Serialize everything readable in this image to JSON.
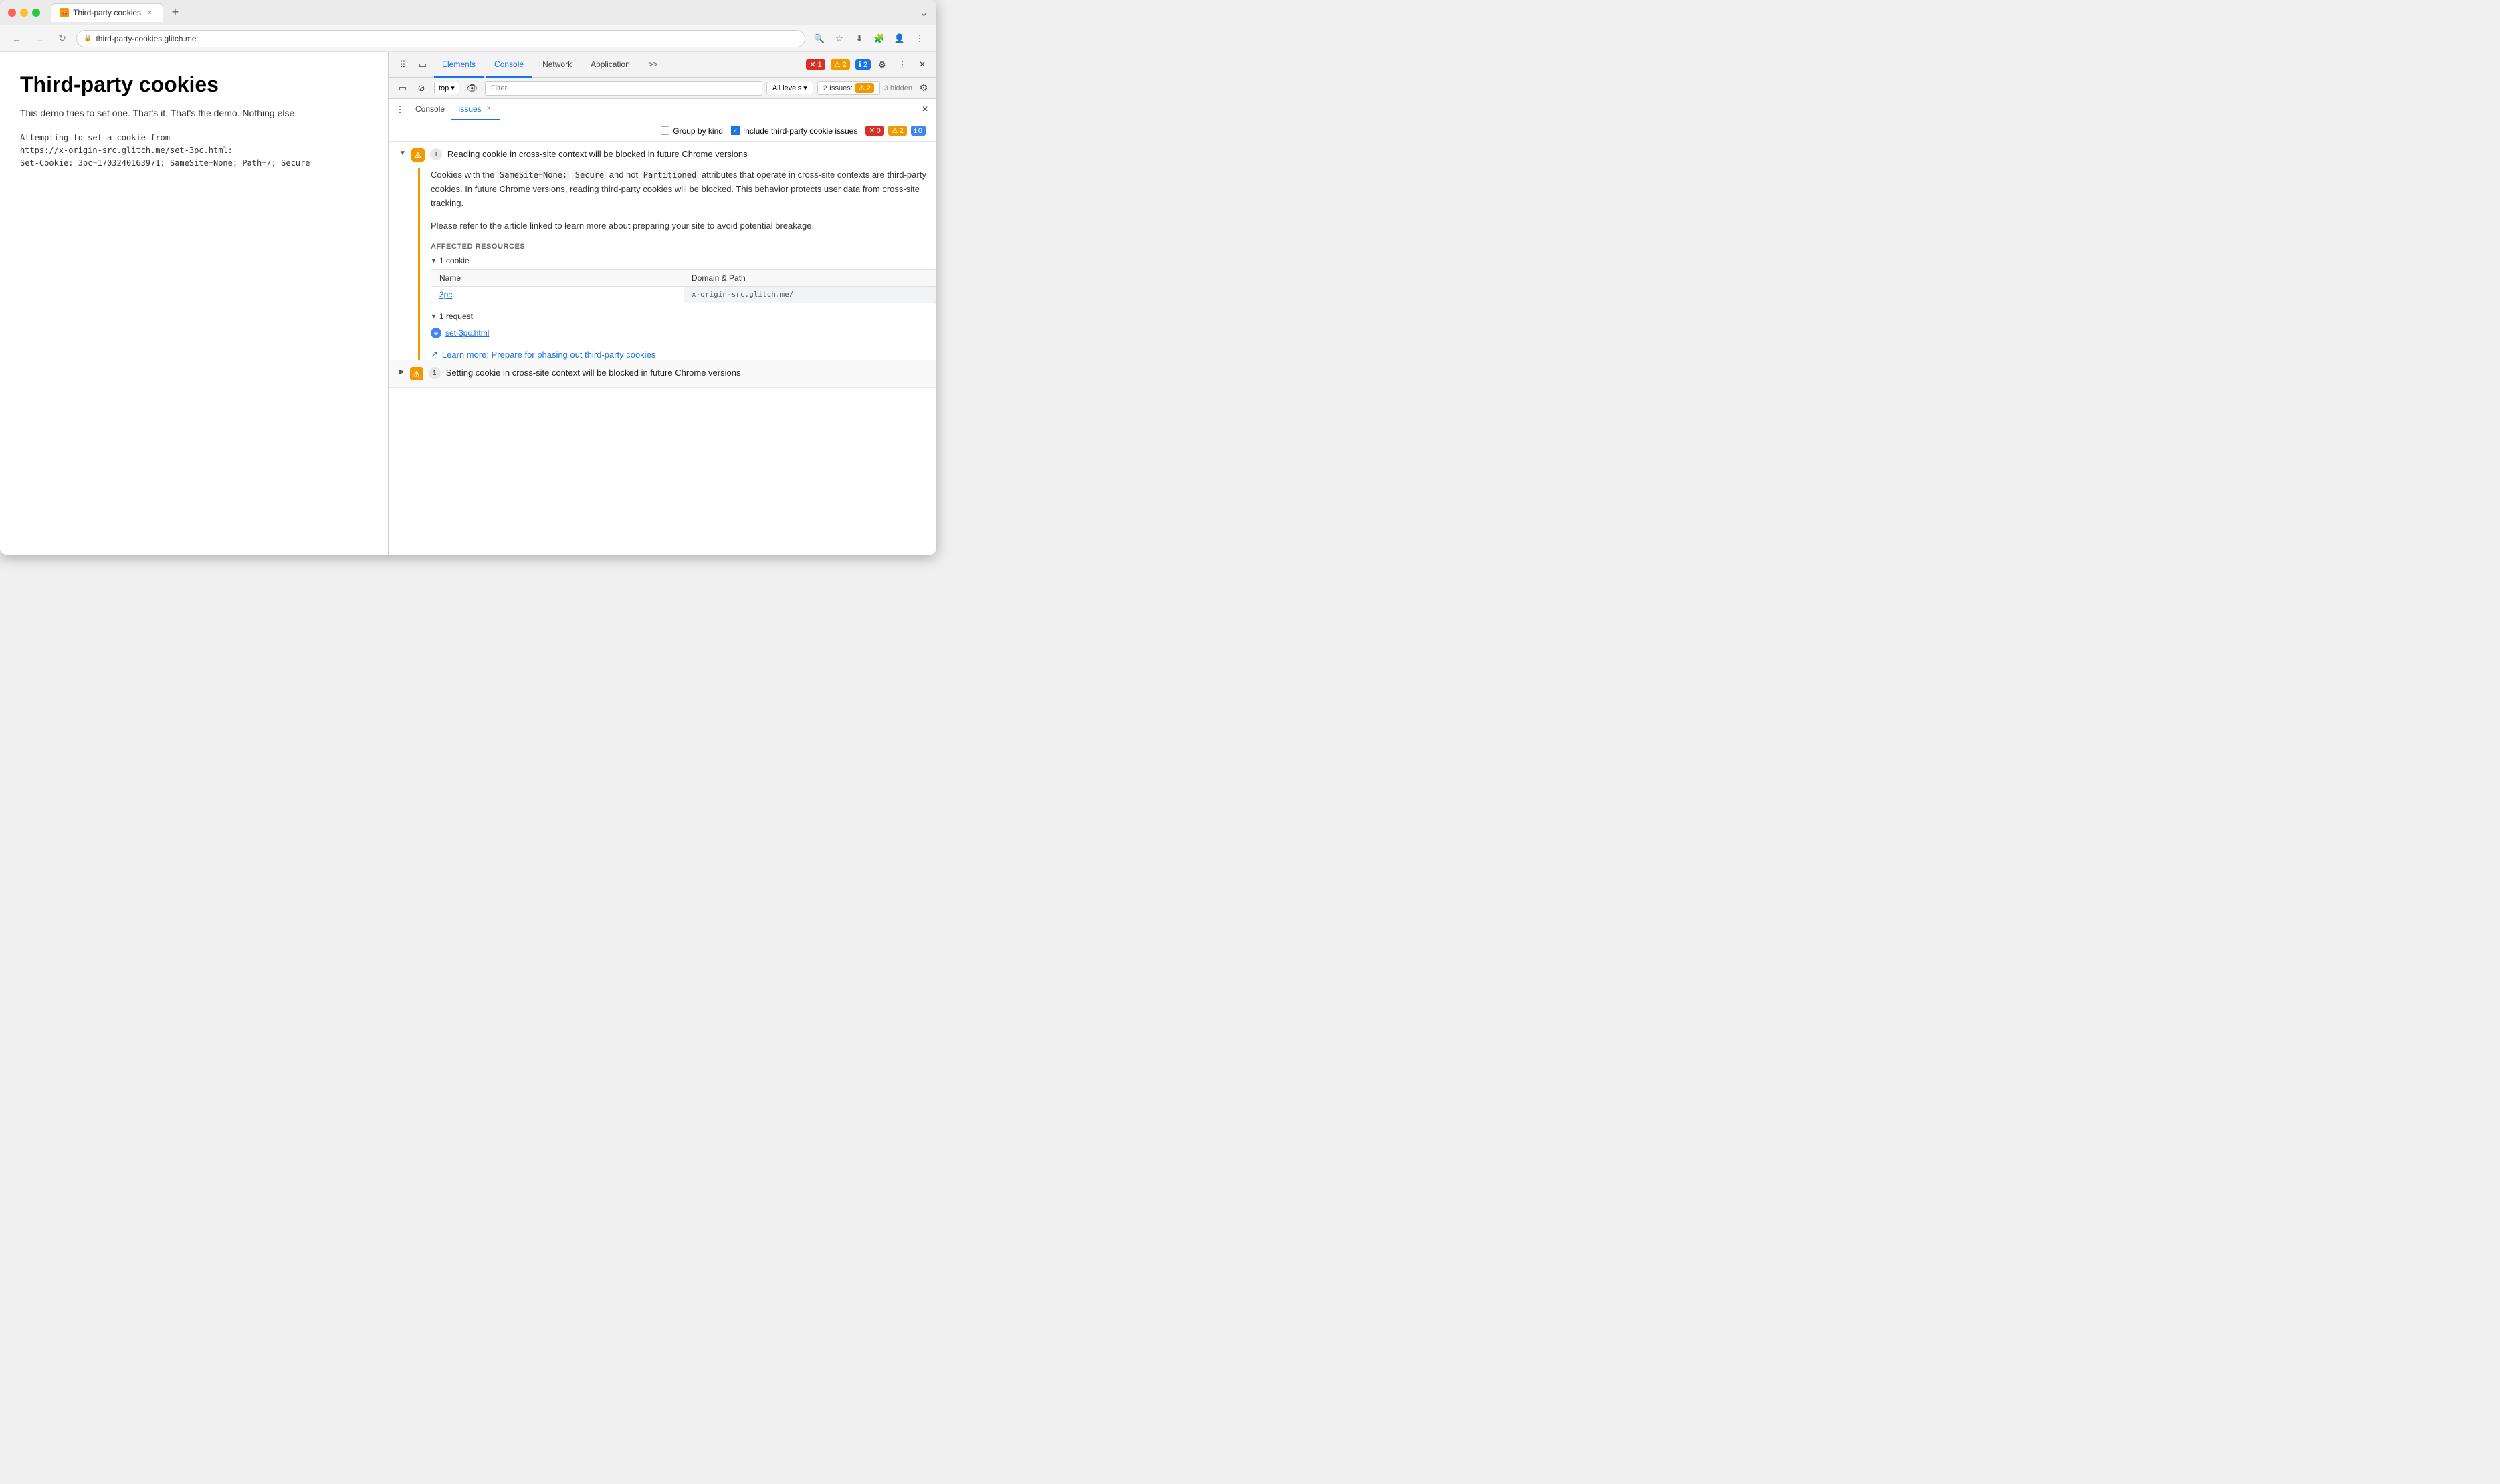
{
  "browser": {
    "tab_title": "Third-party cookies",
    "tab_url": "third-party-cookies.glitch.me",
    "new_tab_label": "+",
    "nav": {
      "back_label": "←",
      "forward_label": "→",
      "refresh_label": "↻",
      "address": "third-party-cookies.glitch.me"
    }
  },
  "page": {
    "title": "Third-party cookies",
    "description": "This demo tries to set one. That's it. That's the demo. Nothing else.",
    "log_line1": "Attempting to set a cookie from",
    "log_line2": "https://x-origin-src.glitch.me/set-3pc.html:",
    "log_line3": "Set-Cookie: 3pc=1703240163971; SameSite=None; Path=/; Secure"
  },
  "devtools": {
    "toolbar": {
      "inspect_icon": "⠿",
      "device_icon": "▭",
      "elements_label": "Elements",
      "console_label": "Console",
      "network_label": "Network",
      "application_label": "Application",
      "more_label": ">>",
      "error_count": "1",
      "warning_count": "2",
      "info_count": "2",
      "settings_icon": "⚙",
      "more_icon": "⋮",
      "close_icon": "×"
    },
    "console_bar": {
      "layout_icon": "▭",
      "no_entry_icon": "⊘",
      "frame_label": "top",
      "eye_icon": "👁",
      "filter_placeholder": "Filter",
      "level_label": "All levels",
      "issues_label": "2 Issues:",
      "issues_warning_count": "2",
      "hidden_label": "3 hidden",
      "gear_icon": "⚙"
    },
    "tabs": {
      "console_label": "Console",
      "issues_label": "Issues",
      "close_icon": "×"
    },
    "issues_panel": {
      "group_by_kind_label": "Group by kind",
      "include_third_party_label": "Include third-party cookie issues",
      "error_count": "0",
      "warning_count": "2",
      "info_count": "0",
      "issue1": {
        "title": "Reading cookie in cross-site context will be blocked in future Chrome versions",
        "count": "1",
        "desc1": "Cookies with the",
        "code1": "SameSite=None;",
        "code2": "Secure",
        "desc2": "and not",
        "code3": "Partitioned",
        "desc3": "attributes that operate in cross-site contexts are third-party cookies. In future Chrome versions, reading third-party cookies will be blocked. This behavior protects user data from cross-site tracking.",
        "desc4": "Please refer to the article linked to learn more about preparing your site to avoid potential breakage.",
        "affected_label": "AFFECTED RESOURCES",
        "cookie_section_label": "1 cookie",
        "col_name": "Name",
        "col_domain": "Domain & Path",
        "cookie_name": "3pc",
        "cookie_domain": "x-origin-src.glitch.me/",
        "request_section_label": "1 request",
        "request_name": "set-3pc.html",
        "learn_more_label": "Learn more: Prepare for phasing out third-party cookies"
      },
      "issue2": {
        "title": "Setting cookie in cross-site context will be blocked in future Chrome versions",
        "count": "1"
      }
    }
  }
}
